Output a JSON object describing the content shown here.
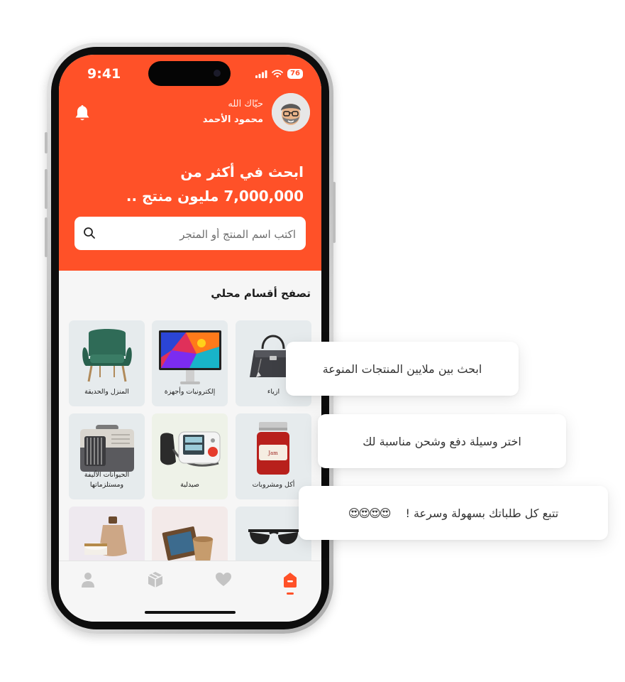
{
  "status_bar": {
    "time": "9:41",
    "battery": "76"
  },
  "header": {
    "greeting": "حيّاك الله",
    "user_name": "محمود الأحمد",
    "headline_line1": "ابحث في أكثر من",
    "headline_line2": "7,000,000 مليون منتج .."
  },
  "search": {
    "placeholder": "اكتب اسم المنتج أو المتجر"
  },
  "categories": {
    "title": "تصفح أقسام محلي",
    "items": [
      {
        "label": "ازياء",
        "icon": "handbag-icon"
      },
      {
        "label": "إلكترونيات وأجهزة",
        "icon": "monitor-icon"
      },
      {
        "label": "المنزل والحديقة",
        "icon": "armchair-icon"
      },
      {
        "label": "أكل ومشروبات",
        "icon": "jam-jar-icon"
      },
      {
        "label": "صيدلية",
        "icon": "blood-pressure-monitor-icon"
      },
      {
        "label": "الحيوانات الأليفة ومستلزماتها",
        "icon": "pet-carrier-icon"
      },
      {
        "label": "",
        "icon": "sunglasses-icon"
      },
      {
        "label": "",
        "icon": "wooden-decor-icon"
      },
      {
        "label": "",
        "icon": "perfume-icon"
      }
    ]
  },
  "tabbar": {
    "items": [
      {
        "name": "home",
        "icon": "home-icon",
        "active": true
      },
      {
        "name": "favorites",
        "icon": "heart-icon",
        "active": false
      },
      {
        "name": "orders",
        "icon": "box-icon",
        "active": false
      },
      {
        "name": "profile",
        "icon": "user-icon",
        "active": false
      }
    ]
  },
  "bubbles": {
    "b1": "ابحث بين ملايين المنتجات المنوعة",
    "b2": "اختر وسيلة دفع وشحن مناسبة لك",
    "b3": "تتبع  كل طلباتك بسهولة وسرعة !",
    "b3_emojis": "😍😍😍😍"
  },
  "colors": {
    "brand": "#ff5128",
    "background": "#f6f6f6",
    "text": "#1c1c1c"
  }
}
